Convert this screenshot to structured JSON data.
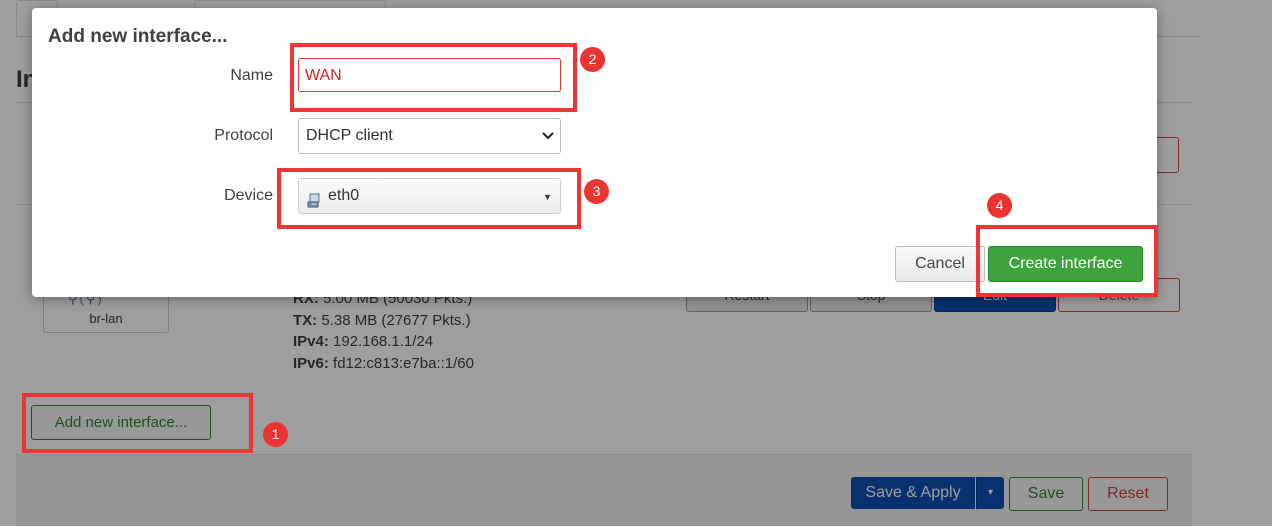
{
  "background": {
    "page_title": "In",
    "device": {
      "label": "br-lan",
      "icons": "⚲(⚲)"
    },
    "stats": [
      {
        "key": "RX:",
        "value": "5.00 MB (50030 Pkts.)"
      },
      {
        "key": "TX:",
        "value": "5.38 MB (27677 Pkts.)"
      },
      {
        "key": "IPv4:",
        "value": "192.168.1.1/24"
      },
      {
        "key": "IPv6:",
        "value": "fd12:c813:e7ba::1/60"
      }
    ],
    "row_buttons": {
      "restart": "Restart",
      "stop": "Stop",
      "edit": "Edit",
      "delete": "Delete"
    },
    "add_button": "Add new interface...",
    "footer": {
      "save_apply": "Save & Apply",
      "dropdown": "▾",
      "save": "Save",
      "reset": "Reset"
    }
  },
  "modal": {
    "title": "Add new interface...",
    "name": {
      "label": "Name",
      "value": "WAN"
    },
    "protocol": {
      "label": "Protocol",
      "value": "DHCP client"
    },
    "device": {
      "label": "Device",
      "value": "eth0"
    },
    "cancel": "Cancel",
    "create": "Create interface"
  },
  "annotations": {
    "badge1": "1",
    "badge2": "2",
    "badge3": "3",
    "badge4": "4"
  },
  "colors": {
    "highlight": "#ef3535",
    "primary": "#0d4fb5",
    "positive": "#3da43d",
    "negative": "#cc4444"
  }
}
